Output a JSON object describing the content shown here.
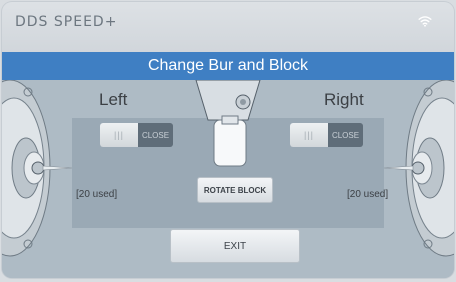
{
  "app": {
    "logo": "DDS SPEED+"
  },
  "title": "Change Bur and Block",
  "left": {
    "label": "Left",
    "toggle_state": "CLOSE",
    "used": "[20 used]"
  },
  "right": {
    "label": "Right",
    "toggle_state": "CLOSE",
    "used": "[20 used]"
  },
  "buttons": {
    "rotate": "ROTATE BLOCK",
    "exit": "EXIT"
  },
  "colors": {
    "accent": "#3f7fc3",
    "toggle_dark": "#5f6d79"
  },
  "icons": {
    "status": "wifi-icon"
  }
}
